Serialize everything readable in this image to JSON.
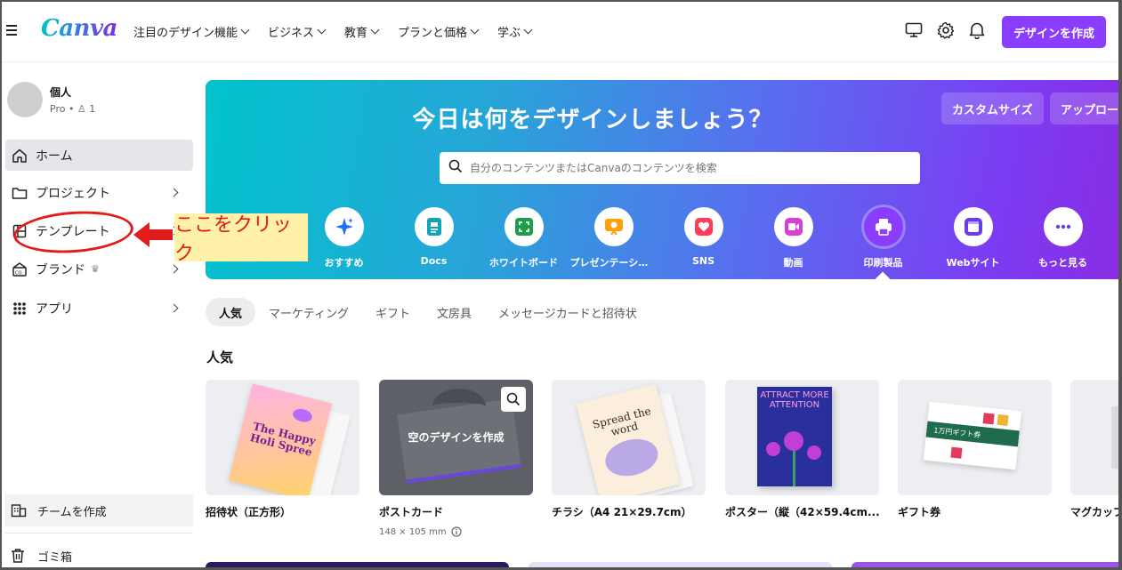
{
  "app": {
    "logo": "Canva"
  },
  "nav": {
    "items": [
      "注目のデザイン機能",
      "ビジネス",
      "教育",
      "プランと価格",
      "学ぶ"
    ],
    "create_label": "デザインを作成"
  },
  "sidebar": {
    "profile_name": "個人",
    "profile_sub": "Pro • ♙ 1",
    "items": [
      {
        "label": "ホーム",
        "icon": "home-icon"
      },
      {
        "label": "プロジェクト",
        "icon": "folder-icon"
      },
      {
        "label": "テンプレート",
        "icon": "template-icon"
      },
      {
        "label": "ブランド",
        "icon": "brand-icon"
      },
      {
        "label": "アプリ",
        "icon": "apps-grid-icon"
      }
    ],
    "team_label": "チームを作成",
    "trash_label": "ゴミ箱"
  },
  "annotation": {
    "label": "ここをクリック",
    "color": "#e21b1b"
  },
  "hero": {
    "title": "今日は何をデザインしましょう？",
    "custom_size": "カスタムサイズ",
    "upload": "アップロード",
    "search_placeholder": "自分のコンテンツまたはCanvaのコンテンツを検索",
    "categories": [
      {
        "label": "おすすめ",
        "icon": "sparkle-icon",
        "color": "#1f6fff"
      },
      {
        "label": "Docs",
        "icon": "docs-icon",
        "color": "#13a3b5"
      },
      {
        "label": "ホワイトボード",
        "icon": "whiteboard-icon",
        "color": "#1c9e4b"
      },
      {
        "label": "プレゼンテーション",
        "icon": "presentation-icon",
        "color": "#ff9f0a"
      },
      {
        "label": "SNS",
        "icon": "heart-icon",
        "color": "#ff3b5c"
      },
      {
        "label": "動画",
        "icon": "video-icon",
        "color": "#d63fd6"
      },
      {
        "label": "印刷製品",
        "icon": "printer-icon",
        "color": "#8b3dff"
      },
      {
        "label": "Webサイト",
        "icon": "website-icon",
        "color": "#6a3cf0"
      },
      {
        "label": "もっと見る",
        "icon": "more-icon",
        "color": "#6a3cf0"
      }
    ]
  },
  "tabs": [
    "人気",
    "マーケティング",
    "ギフト",
    "文房具",
    "メッセージカードと招待状"
  ],
  "section_title": "人気",
  "cards": [
    {
      "title": "招待状（正方形）"
    },
    {
      "title": "ポストカード",
      "sub": "148 × 105 mm",
      "overlay": "空のデザインを作成"
    },
    {
      "title": "チラシ（A4 21×29.7cm）"
    },
    {
      "title": "ポスター（縦（42×59.4cm..."
    },
    {
      "title": "ギフト券"
    },
    {
      "title": "マグカップ"
    }
  ],
  "thumbs": {
    "invite_text": "The Happy Holi Spree",
    "flyer_text": "Spread the word",
    "poster_text": "ATTRACT MORE ATTENTION",
    "gift_text": "1万円ギフト券"
  }
}
